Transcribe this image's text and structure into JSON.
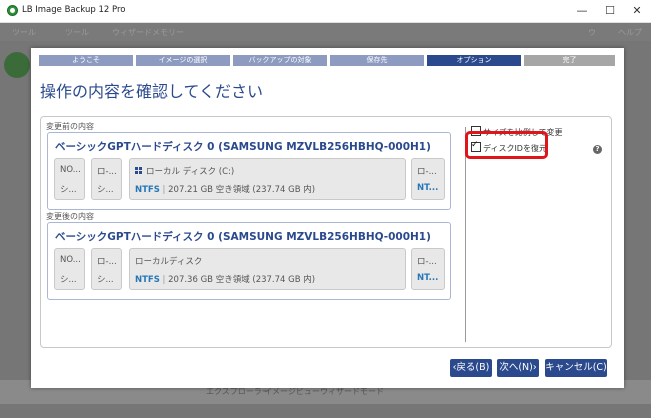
{
  "window": {
    "title": "LB Image Backup 12 Pro",
    "controls": {
      "minimize": "—",
      "maximize": "☐",
      "close": "✕"
    }
  },
  "background_app": {
    "menus": [
      "ツール",
      "ツール",
      "ウィザードメモリー"
    ],
    "right_menus": [
      "ウ",
      "ヘルプ"
    ],
    "bottom_tabs": [
      "エクスプローラー",
      "イメージビュー",
      "ウィザードモード"
    ]
  },
  "wizard": {
    "steps": [
      {
        "label": "ようこそ",
        "state": "pending"
      },
      {
        "label": "イメージの選択",
        "state": "pending"
      },
      {
        "label": "バックアップの対象",
        "state": "pending"
      },
      {
        "label": "保存先",
        "state": "pending"
      },
      {
        "label": "オプション",
        "state": "active"
      },
      {
        "label": "完了",
        "state": "done"
      }
    ],
    "title": "操作の内容を確認してください",
    "before": {
      "label": "変更前の内容",
      "disk_title": "ベーシックGPTハードディスク 0 (SAMSUNG MZVLB256HBHQ-000H1)",
      "partitions": [
        {
          "line1": "NO...",
          "line2": "シ..."
        },
        {
          "line1": "ロ-...",
          "line2": "シ..."
        },
        {
          "line1": "ローカル ディスク (C:)",
          "fs": "NTFS",
          "info": "207.21 GB 空き領域 (237.74 GB 内)"
        },
        {
          "line1": "ロ-...",
          "fs": "NT..."
        }
      ]
    },
    "after": {
      "label": "変更後の内容",
      "disk_title": "ベーシックGPTハードディスク 0 (SAMSUNG MZVLB256HBHQ-000H1)",
      "partitions": [
        {
          "line1": "NO...",
          "line2": "シ..."
        },
        {
          "line1": "ロ-...",
          "line2": "シ..."
        },
        {
          "line1": "ローカルディスク",
          "fs": "NTFS",
          "info": "207.36 GB 空き領域 (237.74 GB 内)"
        },
        {
          "line1": "ロ-...",
          "fs": "NT..."
        }
      ]
    },
    "options": [
      {
        "label": "サイズを比例して変更",
        "checked": false
      },
      {
        "label": "ディスクIDを復元",
        "checked": true
      }
    ],
    "help": "?",
    "buttons": {
      "back": "‹戻る(B)",
      "next": "次へ(N)›",
      "cancel": "キャンセル(C)"
    }
  },
  "colors": {
    "accent": "#2b4a8e",
    "step_pending": "#8e9bc1",
    "highlight": "#e0141b"
  }
}
